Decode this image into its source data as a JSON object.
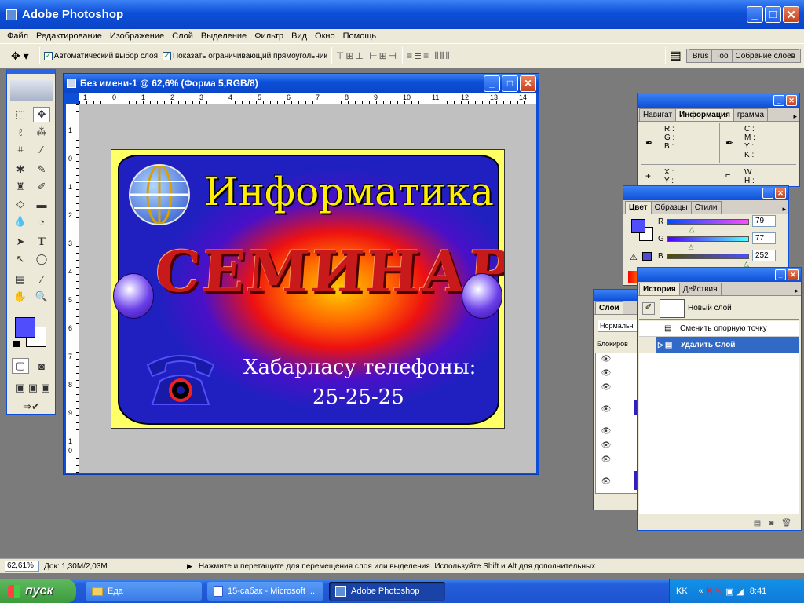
{
  "app": {
    "title": "Adobe Photoshop"
  },
  "menu": [
    "Файл",
    "Редактирование",
    "Изображение",
    "Слой",
    "Выделение",
    "Фильтр",
    "Вид",
    "Окно",
    "Помощь"
  ],
  "options": {
    "auto_select": "Автоматический выбор слоя",
    "show_bounds": "Показать ограничивающий прямоугольник",
    "tabs": [
      "Brus",
      "Too",
      "Собрание слоев"
    ]
  },
  "document": {
    "title": "Без имени-1 @ 62,6% (Форма 5,RGB/8)",
    "ruler": [
      "1",
      "0",
      "1",
      "2",
      "3",
      "4",
      "5",
      "6",
      "7",
      "8",
      "9",
      "10",
      "11",
      "12",
      "13",
      "14"
    ],
    "vruler": [
      "1",
      "0",
      "1",
      "2",
      "3",
      "4",
      "5",
      "6",
      "7",
      "8",
      "9",
      "1",
      "0"
    ]
  },
  "poster": {
    "title": "Информатика",
    "headline": "СЕМИНАР",
    "phone_label": "Хабарласу телефоны:",
    "phone": "25-25-25"
  },
  "info_panel": {
    "tabs": [
      "Навигат",
      "Информация",
      "грамма"
    ],
    "rgb": [
      "R :",
      "G :",
      "B :"
    ],
    "cmyk": [
      "C :",
      "M :",
      "Y :",
      "K :"
    ],
    "xy": [
      "X :",
      "Y :"
    ],
    "wh": [
      "W :",
      "H :"
    ]
  },
  "color_panel": {
    "tabs": [
      "Цвет",
      "Образцы",
      "Стили"
    ],
    "r_label": "R",
    "g_label": "G",
    "b_label": "B",
    "r": "79",
    "g": "77",
    "b": "252",
    "fg_color": "#4f4dfc",
    "r_level": 0.31,
    "g_level": 0.3,
    "b_level": 0.99
  },
  "layers_panel": {
    "tab": "Слои",
    "blend": "Нормальн",
    "lock": "Блокиров"
  },
  "history_panel": {
    "tabs": [
      "История",
      "Действия"
    ],
    "snapshot": "Новый слой",
    "items": [
      "Сменить опорную точку",
      "Удалить Слой"
    ]
  },
  "status": {
    "zoom": "62,61%",
    "doc": "Док: 1,30M/2,03M",
    "hint": "Нажмите и перетащите для перемещения слоя или выделения. Используйте Shift и Alt для дополнительных"
  },
  "taskbar": {
    "start": "пуск",
    "items": [
      "Еда",
      "15-сабак - Microsoft ...",
      "Adobe Photoshop"
    ],
    "lang": "KK",
    "clock": "8:41"
  }
}
